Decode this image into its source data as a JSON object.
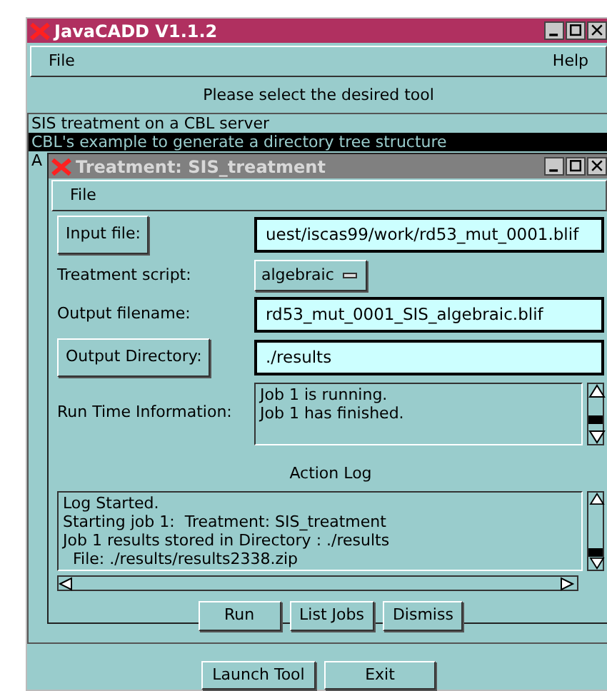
{
  "window": {
    "title": "JavaCADD V1.1.2"
  },
  "menu": [
    "File",
    "Help"
  ],
  "heading": "Please select the desired tool",
  "tools": [
    {
      "label": "SIS treatment on a CBL server",
      "selected": false
    },
    {
      "label": "CBL's example to generate a directory tree structure",
      "selected": true
    },
    {
      "label": "A",
      "selected": false
    }
  ],
  "dialog": {
    "title": "Treatment: SIS_treatment",
    "menu": [
      "File"
    ],
    "fields": [
      {
        "kind": "button",
        "label": "Input file:",
        "value": "uest/iscas99/work/rd53_mut_0001.blif"
      },
      {
        "kind": "dropdown",
        "label": "Treatment script:",
        "value": "algebraic"
      },
      {
        "kind": "text",
        "label": "Output filename:",
        "value": "rd53_mut_0001_SIS_algebraic.blif"
      },
      {
        "kind": "button",
        "label": "Output Directory:",
        "value": "./results"
      },
      {
        "kind": "area",
        "label": "Run Time Information:",
        "lines": [
          "Job 1 is running.",
          "Job 1 has finished."
        ]
      }
    ],
    "log_title": "Action Log",
    "log": [
      "Log Started.",
      "Starting job 1:  Treatment: SIS_treatment",
      "Job 1 results stored in Directory : ./results",
      "  File: ./results/results2338.zip"
    ],
    "buttons": [
      "Run",
      "List Jobs",
      "Dismiss"
    ]
  },
  "buttons": [
    "Launch Tool",
    "Exit"
  ]
}
